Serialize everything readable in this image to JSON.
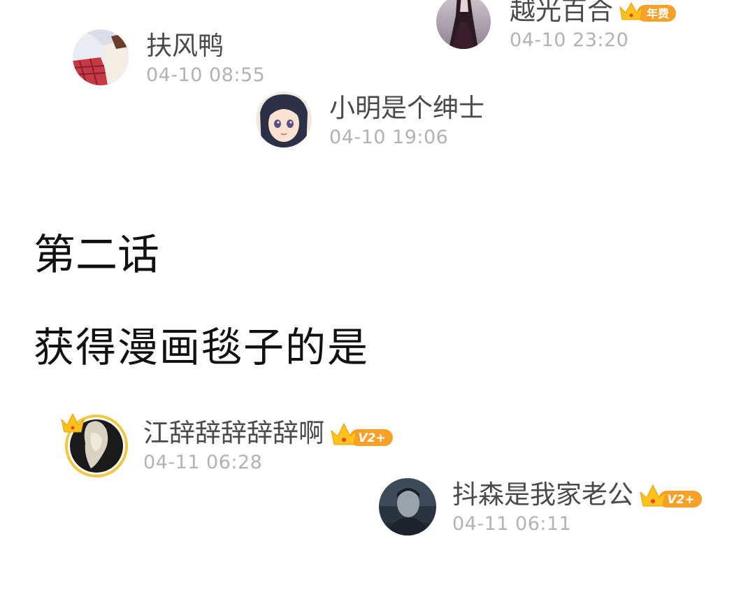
{
  "comments_top": [
    {
      "username": "越光百合",
      "timestamp": "04-10 23:20",
      "badge": {
        "icon": "crown-icon",
        "label": "年费",
        "color": "#f7a128"
      }
    },
    {
      "username": "扶风鸭",
      "timestamp": "04-10 08:55"
    },
    {
      "username": "小明是个绅士",
      "timestamp": "04-10 19:06"
    }
  ],
  "headings": {
    "episode": "第二话",
    "winner_caption": "获得漫画毯子的是"
  },
  "comments_bottom": [
    {
      "username": "江辞辞辞辞辞啊",
      "timestamp": "04-11 06:28",
      "badge": {
        "icon": "crown-icon",
        "label": "V2+",
        "color": "#f7a128"
      },
      "avatar_frame": "gold-crown-frame"
    },
    {
      "username": "抖森是我家老公",
      "timestamp": "04-11 06:11",
      "badge": {
        "icon": "crown-icon",
        "label": "V2+",
        "color": "#f7a128"
      }
    }
  ],
  "colors": {
    "username": "#4a4a4a",
    "timestamp": "#b3b3b3",
    "heading": "#111111",
    "badge_orange": "#f7a128",
    "crown_yellow": "#ffc21a"
  }
}
